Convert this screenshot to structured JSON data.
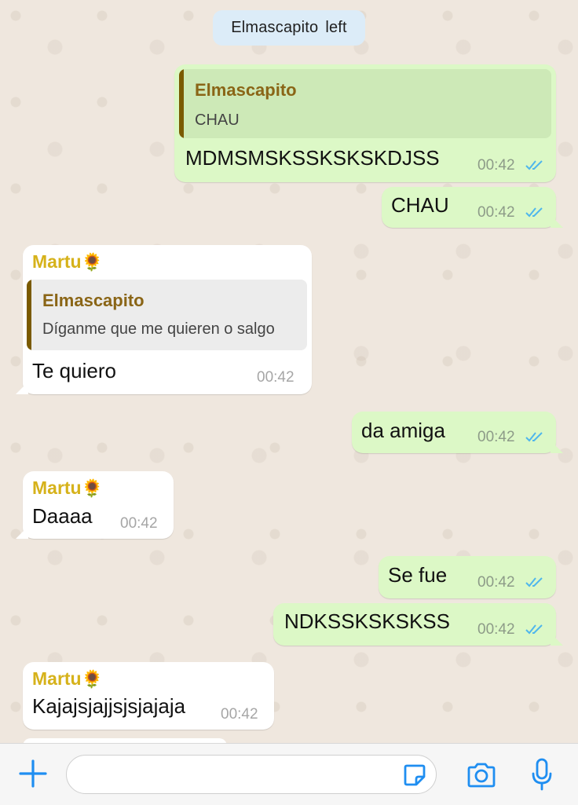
{
  "system_message": {
    "user": "Elmascapito",
    "action": "left"
  },
  "colors": {
    "outgoing": "#dcf8c6",
    "incoming": "#ffffff",
    "read_ticks": "#4fb6ec",
    "sender_name": "#d6b21b",
    "accent_blue": "#1f8ef1"
  },
  "messages": [
    {
      "direction": "out",
      "quote": {
        "author": "Elmascapito",
        "text": "CHAU"
      },
      "text": "MDMSMSKSSKSKSKDJSS",
      "time": "00:42",
      "status": "read"
    },
    {
      "direction": "out",
      "text": "CHAU",
      "time": "00:42",
      "status": "read"
    },
    {
      "direction": "in",
      "sender": "Martu",
      "sender_emoji": "🌻",
      "quote": {
        "author": "Elmascapito",
        "text": "Díganme que me quieren o salgo"
      },
      "text": "Te quiero",
      "time": "00:42"
    },
    {
      "direction": "out",
      "text": "da amiga",
      "time": "00:42",
      "status": "read"
    },
    {
      "direction": "in",
      "sender": "Martu",
      "sender_emoji": "🌻",
      "text": "Daaaa",
      "time": "00:42"
    },
    {
      "direction": "out",
      "text": "Se fue",
      "time": "00:42",
      "status": "read"
    },
    {
      "direction": "out",
      "text": "NDKSSKSKSKSS",
      "time": "00:42",
      "status": "read"
    },
    {
      "direction": "in",
      "sender": "Martu",
      "sender_emoji": "🌻",
      "text": "Kajajsjajjsjsjajaja",
      "time": "00:42"
    }
  ],
  "input_bar": {
    "icons": [
      "plus-icon",
      "sticker-icon",
      "camera-icon",
      "microphone-icon"
    ],
    "input_value": ""
  }
}
